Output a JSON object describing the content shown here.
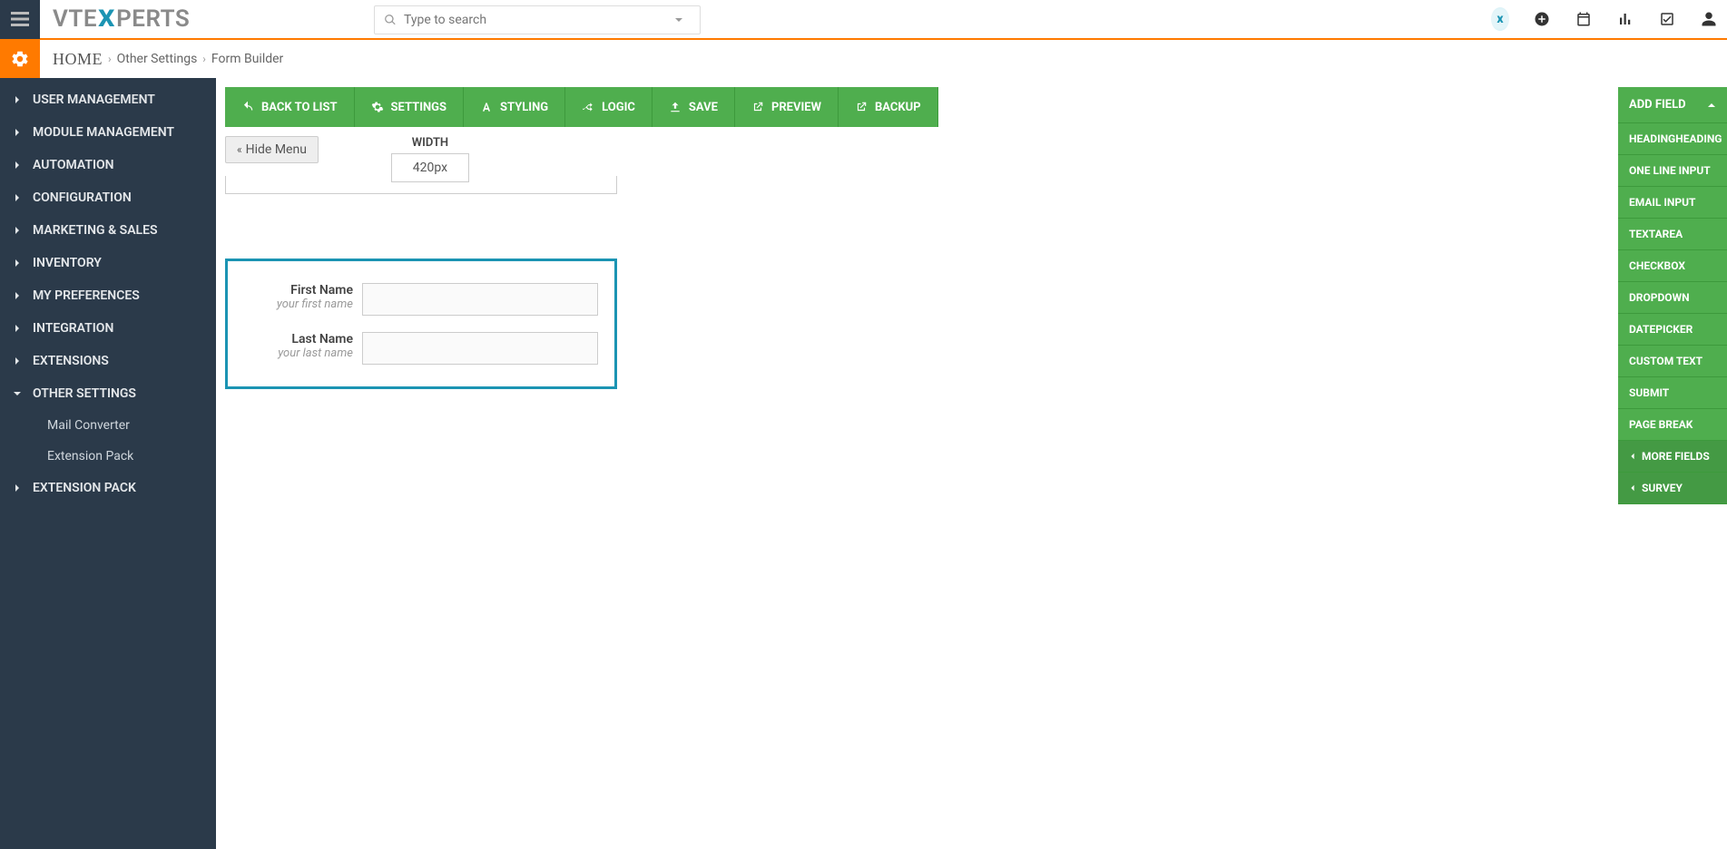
{
  "search": {
    "placeholder": "Type to search"
  },
  "breadcrumbs": {
    "home": "HOME",
    "mid": "Other Settings",
    "last": "Form Builder"
  },
  "sidebar": {
    "items": [
      {
        "label": "USER MANAGEMENT",
        "expanded": false
      },
      {
        "label": "MODULE MANAGEMENT",
        "expanded": false
      },
      {
        "label": "AUTOMATION",
        "expanded": false
      },
      {
        "label": "CONFIGURATION",
        "expanded": false
      },
      {
        "label": "MARKETING & SALES",
        "expanded": false
      },
      {
        "label": "INVENTORY",
        "expanded": false
      },
      {
        "label": "MY PREFERENCES",
        "expanded": false
      },
      {
        "label": "INTEGRATION",
        "expanded": false
      },
      {
        "label": "EXTENSIONS",
        "expanded": false
      },
      {
        "label": "OTHER SETTINGS",
        "expanded": true,
        "children": [
          "Mail Converter",
          "Extension Pack"
        ]
      },
      {
        "label": "EXTENSION PACK",
        "expanded": false
      }
    ]
  },
  "actions": {
    "back": "BACK TO LIST",
    "settings": "SETTINGS",
    "styling": "STYLING",
    "logic": "LOGIC",
    "save": "SAVE",
    "preview": "PREVIEW",
    "backup": "BACKUP"
  },
  "hide_menu": "Hide Menu",
  "width": {
    "label": "WIDTH",
    "value": "420px"
  },
  "form": {
    "fields": [
      {
        "label": "First Name",
        "hint": "your first name"
      },
      {
        "label": "Last Name",
        "hint": "your last name"
      }
    ]
  },
  "rightpanel": {
    "title": "ADD FIELD",
    "items": [
      "HEADINGHEADING",
      "ONE LINE INPUT",
      "EMAIL INPUT",
      "TEXTAREA",
      "CHECKBOX",
      "DROPDOWN",
      "DATEPICKER",
      "CUSTOM TEXT",
      "SUBMIT",
      "PAGE BREAK"
    ],
    "more": "MORE FIELDS",
    "survey": "SURVEY"
  }
}
